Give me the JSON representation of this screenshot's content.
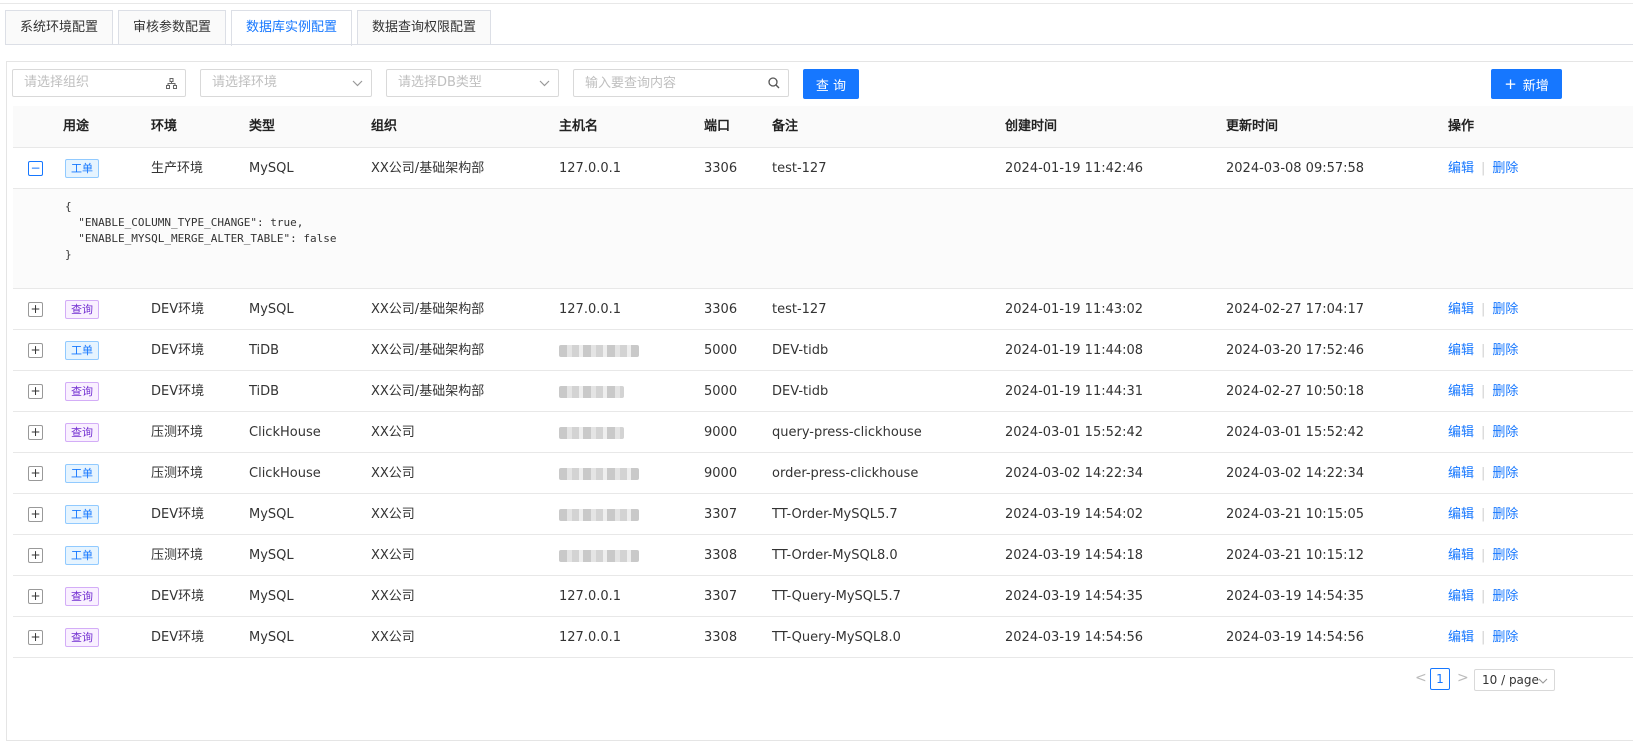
{
  "tabs": [
    {
      "label": "系统环境配置",
      "active": false
    },
    {
      "label": "审核参数配置",
      "active": false
    },
    {
      "label": "数据库实例配置",
      "active": true
    },
    {
      "label": "数据查询权限配置",
      "active": false
    }
  ],
  "filters": {
    "org_placeholder": "请选择组织",
    "env_placeholder": "请选择环境",
    "dbtype_placeholder": "请选择DB类型",
    "search_placeholder": "输入要查询内容",
    "query_button": "查 询",
    "add_button": "新增"
  },
  "table": {
    "columns": [
      "用途",
      "环境",
      "类型",
      "组织",
      "主机名",
      "端口",
      "备注",
      "创建时间",
      "更新时间",
      "操作"
    ],
    "rows": [
      {
        "purpose": "工单",
        "env": "生产环境",
        "type": "MySQL",
        "org": "XX公司/基础架构部",
        "host": "127.0.0.1",
        "port": "3306",
        "remark": "test-127",
        "created": "2024-01-19 11:42:46",
        "updated": "2024-03-08 09:57:58",
        "edit": "编辑",
        "del": "删除",
        "expanded": true,
        "expander": "−"
      },
      {
        "purpose": "查询",
        "env": "DEV环境",
        "type": "MySQL",
        "org": "XX公司/基础架构部",
        "host": "127.0.0.1",
        "port": "3306",
        "remark": "test-127",
        "created": "2024-01-19 11:43:02",
        "updated": "2024-02-27 17:04:17",
        "edit": "编辑",
        "del": "删除",
        "expander": "+"
      },
      {
        "purpose": "工单",
        "env": "DEV环境",
        "type": "TiDB",
        "org": "XX公司/基础架构部",
        "host": "",
        "port": "5000",
        "remark": "DEV-tidb",
        "created": "2024-01-19 11:44:08",
        "updated": "2024-03-20 17:52:46",
        "edit": "编辑",
        "del": "删除",
        "expander": "+"
      },
      {
        "purpose": "查询",
        "env": "DEV环境",
        "type": "TiDB",
        "org": "XX公司/基础架构部",
        "host": "",
        "port": "5000",
        "remark": "DEV-tidb",
        "created": "2024-01-19 11:44:31",
        "updated": "2024-02-27 10:50:18",
        "edit": "编辑",
        "del": "删除",
        "expander": "+"
      },
      {
        "purpose": "查询",
        "env": "压测环境",
        "type": "ClickHouse",
        "org": "XX公司",
        "host": "",
        "port": "9000",
        "remark": "query-press-clickhouse",
        "created": "2024-03-01 15:52:42",
        "updated": "2024-03-01 15:52:42",
        "edit": "编辑",
        "del": "删除",
        "expander": "+"
      },
      {
        "purpose": "工单",
        "env": "压测环境",
        "type": "ClickHouse",
        "org": "XX公司",
        "host": "",
        "port": "9000",
        "remark": "order-press-clickhouse",
        "created": "2024-03-02 14:22:34",
        "updated": "2024-03-02 14:22:34",
        "edit": "编辑",
        "del": "删除",
        "expander": "+"
      },
      {
        "purpose": "工单",
        "env": "DEV环境",
        "type": "MySQL",
        "org": "XX公司",
        "host": "",
        "port": "3307",
        "remark": "TT-Order-MySQL5.7",
        "created": "2024-03-19 14:54:02",
        "updated": "2024-03-21 10:15:05",
        "edit": "编辑",
        "del": "删除",
        "expander": "+"
      },
      {
        "purpose": "工单",
        "env": "压测环境",
        "type": "MySQL",
        "org": "XX公司",
        "host": "",
        "port": "3308",
        "remark": "TT-Order-MySQL8.0",
        "created": "2024-03-19 14:54:18",
        "updated": "2024-03-21 10:15:12",
        "edit": "编辑",
        "del": "删除",
        "expander": "+"
      },
      {
        "purpose": "查询",
        "env": "DEV环境",
        "type": "MySQL",
        "org": "XX公司",
        "host": "127.0.0.1",
        "port": "3307",
        "remark": "TT-Query-MySQL5.7",
        "created": "2024-03-19 14:54:35",
        "updated": "2024-03-19 14:54:35",
        "edit": "编辑",
        "del": "删除",
        "expander": "+"
      },
      {
        "purpose": "查询",
        "env": "DEV环境",
        "type": "MySQL",
        "org": "XX公司",
        "host": "127.0.0.1",
        "port": "3308",
        "remark": "TT-Query-MySQL8.0",
        "created": "2024-03-19 14:54:56",
        "updated": "2024-03-19 14:54:56",
        "edit": "编辑",
        "del": "删除",
        "expander": "+"
      }
    ],
    "expanded_json": "{\n  \"ENABLE_COLUMN_TYPE_CHANGE\": true,\n  \"ENABLE_MYSQL_MERGE_ALTER_TABLE\": false\n}"
  },
  "pagination": {
    "current_page": "1",
    "prev": "<",
    "next": ">",
    "page_size": "10 / page"
  },
  "colors": {
    "primary": "#1677ff",
    "tag_order": "#1677ff",
    "tag_query": "#722ed1"
  }
}
